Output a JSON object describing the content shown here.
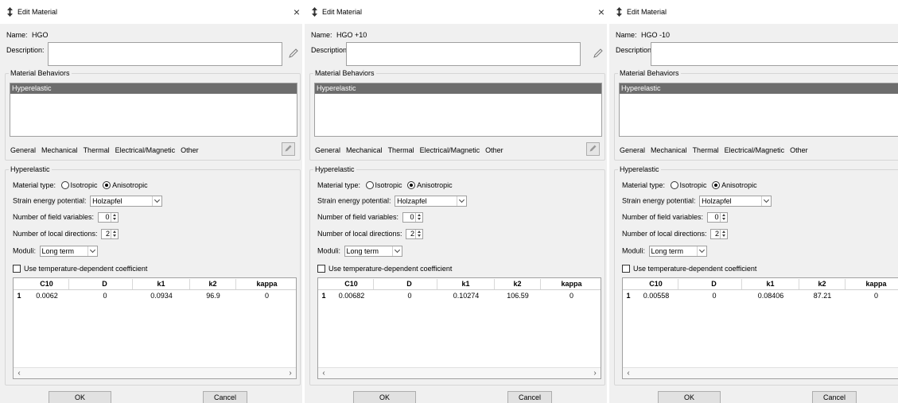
{
  "dialogs": [
    {
      "title": "Edit Material",
      "name_label": "Name:",
      "name": "HGO",
      "description_label": "Description:",
      "behaviors_label": "Material Behaviors",
      "behaviors": [
        "Hyperelastic"
      ],
      "menu": [
        "General",
        "Mechanical",
        "Thermal",
        "Electrical/Magnetic",
        "Other"
      ],
      "section_label": "Hyperelastic",
      "material_type_label": "Material type:",
      "isotropic_label": "Isotropic",
      "anisotropic_label": "Anisotropic",
      "material_type_selected": "Anisotropic",
      "strain_energy_label": "Strain energy potential:",
      "strain_energy_value": "Holzapfel",
      "field_vars_label": "Number of field variables:",
      "field_vars_value": "0",
      "local_dirs_label": "Number of local directions:",
      "local_dirs_value": "2",
      "moduli_label": "Moduli:",
      "moduli_value": "Long term",
      "temp_coeff_label": "Use temperature-dependent coefficient",
      "temp_coeff_checked": false,
      "table": {
        "columns": [
          "C10",
          "D",
          "k1",
          "k2",
          "kappa"
        ],
        "rows": [
          [
            "1",
            "0.0062",
            "0",
            "0.0934",
            "96.9",
            "0"
          ]
        ]
      },
      "ok_label": "OK",
      "cancel_label": "Cancel"
    },
    {
      "title": "Edit Material",
      "name_label": "Name:",
      "name": "HGO +10",
      "description_label": "Description:",
      "behaviors_label": "Material Behaviors",
      "behaviors": [
        "Hyperelastic"
      ],
      "menu": [
        "General",
        "Mechanical",
        "Thermal",
        "Electrical/Magnetic",
        "Other"
      ],
      "section_label": "Hyperelastic",
      "material_type_label": "Material type:",
      "isotropic_label": "Isotropic",
      "anisotropic_label": "Anisotropic",
      "material_type_selected": "Anisotropic",
      "strain_energy_label": "Strain energy potential:",
      "strain_energy_value": "Holzapfel",
      "field_vars_label": "Number of field variables:",
      "field_vars_value": "0",
      "local_dirs_label": "Number of local directions:",
      "local_dirs_value": "2",
      "moduli_label": "Moduli:",
      "moduli_value": "Long term",
      "temp_coeff_label": "Use temperature-dependent coefficient",
      "temp_coeff_checked": false,
      "table": {
        "columns": [
          "C10",
          "D",
          "k1",
          "k2",
          "kappa"
        ],
        "rows": [
          [
            "1",
            "0.00682",
            "0",
            "0.10274",
            "106.59",
            "0"
          ]
        ]
      },
      "ok_label": "OK",
      "cancel_label": "Cancel"
    },
    {
      "title": "Edit Material",
      "name_label": "Name:",
      "name": "HGO -10",
      "description_label": "Description:",
      "behaviors_label": "Material Behaviors",
      "behaviors": [
        "Hyperelastic"
      ],
      "menu": [
        "General",
        "Mechanical",
        "Thermal",
        "Electrical/Magnetic",
        "Other"
      ],
      "section_label": "Hyperelastic",
      "material_type_label": "Material type:",
      "isotropic_label": "Isotropic",
      "anisotropic_label": "Anisotropic",
      "material_type_selected": "Anisotropic",
      "strain_energy_label": "Strain energy potential:",
      "strain_energy_value": "Holzapfel",
      "field_vars_label": "Number of field variables:",
      "field_vars_value": "0",
      "local_dirs_label": "Number of local directions:",
      "local_dirs_value": "2",
      "moduli_label": "Moduli:",
      "moduli_value": "Long term",
      "temp_coeff_label": "Use temperature-dependent coefficient",
      "temp_coeff_checked": false,
      "table": {
        "columns": [
          "C10",
          "D",
          "k1",
          "k2",
          "kappa"
        ],
        "rows": [
          [
            "1",
            "0.00558",
            "0",
            "0.08406",
            "87.21",
            "0"
          ]
        ]
      },
      "ok_label": "OK",
      "cancel_label": "Cancel"
    }
  ],
  "icons": {
    "title": "move-arrows-icon",
    "close": "close-icon",
    "pencil": "pencil-icon",
    "edit": "edit-behavior-icon",
    "scroll_left": "scroll-left-icon",
    "scroll_right": "scroll-right-icon"
  }
}
